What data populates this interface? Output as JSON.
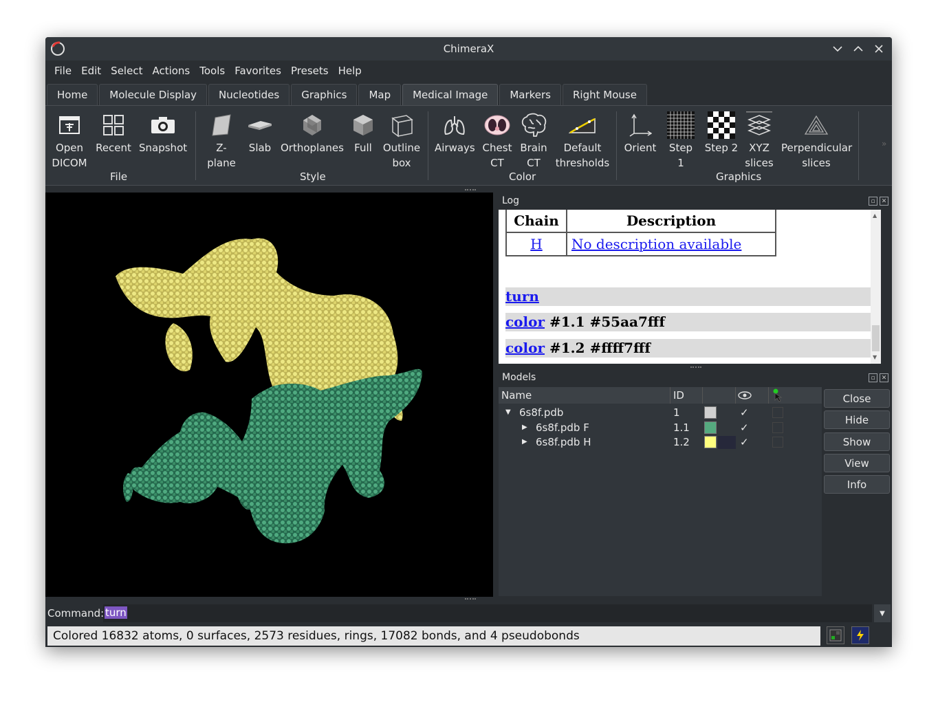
{
  "window": {
    "title": "ChimeraX"
  },
  "menubar": [
    "File",
    "Edit",
    "Select",
    "Actions",
    "Tools",
    "Favorites",
    "Presets",
    "Help"
  ],
  "tabs": [
    {
      "label": "Home"
    },
    {
      "label": "Molecule Display"
    },
    {
      "label": "Nucleotides"
    },
    {
      "label": "Graphics"
    },
    {
      "label": "Map"
    },
    {
      "label": "Medical Image",
      "active": true
    },
    {
      "label": "Markers"
    },
    {
      "label": "Right Mouse"
    }
  ],
  "ribbon": {
    "buttons": {
      "open_dicom": [
        "Open",
        "DICOM"
      ],
      "recent": [
        "Recent"
      ],
      "snapshot": [
        "Snapshot"
      ],
      "zplane": [
        "Z-plane"
      ],
      "slab": [
        "Slab"
      ],
      "orthoplanes": [
        "Orthoplanes"
      ],
      "full": [
        "Full"
      ],
      "outline_box": [
        "Outline",
        "box"
      ],
      "airways": [
        "Airways"
      ],
      "chest_ct": [
        "Chest",
        "CT"
      ],
      "brain_ct": [
        "Brain",
        "CT"
      ],
      "default_thresholds": [
        "Default",
        "thresholds"
      ],
      "orient": [
        "Orient"
      ],
      "step1": [
        "Step 1"
      ],
      "step2": [
        "Step 2"
      ],
      "xyz_slices": [
        "XYZ",
        "slices"
      ],
      "perpendicular_slices": [
        "Perpendicular",
        "slices"
      ]
    },
    "groups": {
      "file": "File",
      "style": "Style",
      "color": "Color",
      "graphics": "Graphics"
    }
  },
  "log": {
    "title": "Log",
    "table": {
      "headers": [
        "Chain",
        "Description"
      ],
      "rows": [
        [
          "H",
          "No description available"
        ]
      ]
    },
    "lines": [
      {
        "link": "turn",
        "rest": ""
      },
      {
        "link": "color",
        "rest": " #1.1 #55aa7fff"
      },
      {
        "link": "color",
        "rest": " #1.2 #ffff7fff"
      }
    ]
  },
  "models": {
    "title": "Models",
    "headers": {
      "name": "Name",
      "id": "ID"
    },
    "rows": [
      {
        "name": "6s8f.pdb",
        "id": "1",
        "color": "#d0d0d0",
        "shown": "✓",
        "expanded": true
      },
      {
        "name": "6s8f.pdb F",
        "id": "1.1",
        "color": "#55aa7f",
        "shown": "✓",
        "expanded": false
      },
      {
        "name": "6s8f.pdb H",
        "id": "1.2",
        "color": "#ffff7f",
        "shown": "✓",
        "expanded": false
      }
    ],
    "buttons": [
      "Close",
      "Hide",
      "Show",
      "View",
      "Info"
    ]
  },
  "command": {
    "label": "Command:",
    "value": "turn"
  },
  "status": {
    "text": "Colored 16832 atoms, 0 surfaces, 2573 residues, rings, 17082 bonds, and 4 pseudobonds"
  },
  "colors": {
    "chain_f": "#55aa7f",
    "chain_h": "#ffff7f",
    "accent": "#7e57c2"
  }
}
